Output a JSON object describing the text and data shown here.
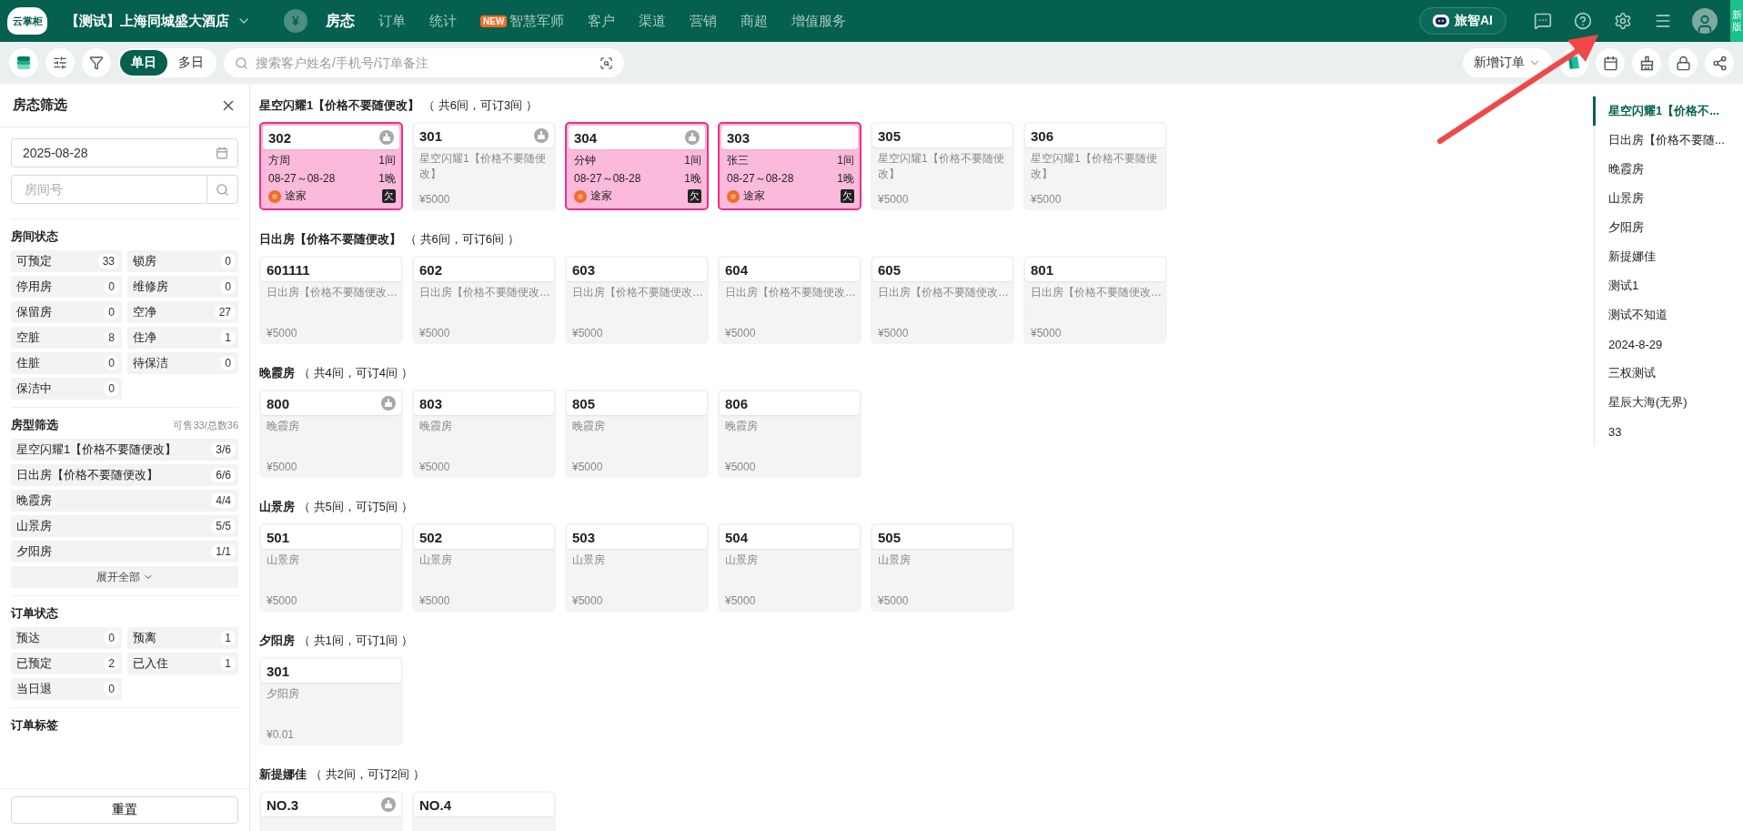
{
  "topbar": {
    "logo": "云掌柜",
    "hotel": "【测试】上海同城盛大酒店",
    "currency": "¥",
    "nav": [
      {
        "label": "房态",
        "selected": true
      },
      {
        "label": "订单",
        "selected": false
      },
      {
        "label": "统计",
        "selected": false
      },
      {
        "label": "智慧军师",
        "selected": false,
        "badge": "NEW"
      },
      {
        "label": "客户",
        "selected": false
      },
      {
        "label": "渠道",
        "selected": false
      },
      {
        "label": "营销",
        "selected": false
      },
      {
        "label": "商超",
        "selected": false
      },
      {
        "label": "增值服务",
        "selected": false
      }
    ],
    "ai_button": "旅智AI",
    "version_tab": "新版"
  },
  "toolbar": {
    "views": [
      {
        "label": "单日",
        "selected": true
      },
      {
        "label": "多日",
        "selected": false
      }
    ],
    "search": {
      "placeholder": "搜索客户姓名/手机号/订单备注"
    },
    "new_order": "新增订单"
  },
  "sidebar": {
    "title": "房态筛选",
    "date": "2025-08-28",
    "room_search": {
      "placeholder": "房间号"
    },
    "room_status": {
      "title": "房间状态",
      "items": [
        {
          "label": "可预定",
          "count": "33"
        },
        {
          "label": "锁房",
          "count": "0"
        },
        {
          "label": "停用房",
          "count": "0"
        },
        {
          "label": "维修房",
          "count": "0"
        },
        {
          "label": "保留房",
          "count": "0"
        },
        {
          "label": "空净",
          "count": "27"
        },
        {
          "label": "空脏",
          "count": "8"
        },
        {
          "label": "住净",
          "count": "1"
        },
        {
          "label": "住脏",
          "count": "0"
        },
        {
          "label": "待保洁",
          "count": "0"
        },
        {
          "label": "保洁中",
          "count": "0"
        }
      ]
    },
    "room_types": {
      "title": "房型筛选",
      "summary": "可售33/总数36",
      "items": [
        {
          "label": "星空闪耀1【价格不要随便改】",
          "count": "3/6"
        },
        {
          "label": "日出房【价格不要随便改】",
          "count": "6/6"
        },
        {
          "label": "晚霞房",
          "count": "4/4"
        },
        {
          "label": "山景房",
          "count": "5/5"
        },
        {
          "label": "夕阳房",
          "count": "1/1"
        }
      ],
      "expand": "展开全部"
    },
    "order_status": {
      "title": "订单状态",
      "items": [
        {
          "label": "预达",
          "count": "0"
        },
        {
          "label": "预离",
          "count": "1"
        },
        {
          "label": "已预定",
          "count": "2"
        },
        {
          "label": "已入住",
          "count": "1"
        },
        {
          "label": "当日退",
          "count": "0"
        }
      ]
    },
    "order_tags": {
      "title": "订单标签"
    },
    "reset": "重置"
  },
  "groups": [
    {
      "name": "星空闪耀1【价格不要随便改】",
      "summary": "（ 共6间，可订3间 ）",
      "rooms": [
        {
          "number": "302",
          "kind": "booked",
          "dirty": true,
          "guest": "方周",
          "rooms": "1间",
          "dates": "08-27～08-28",
          "nights": "1晚",
          "source": "途家",
          "badge": "欠"
        },
        {
          "number": "301",
          "kind": "vacant",
          "dirty": true,
          "type": "星空闪耀1【价格不要随便改】",
          "price": "¥5000"
        },
        {
          "number": "304",
          "kind": "booked",
          "dirty": true,
          "guest": "分钟",
          "rooms": "1间",
          "dates": "08-27～08-28",
          "nights": "1晚",
          "source": "途家",
          "badge": "欠"
        },
        {
          "number": "303",
          "kind": "booked",
          "dirty": false,
          "guest": "张三",
          "rooms": "1间",
          "dates": "08-27～08-28",
          "nights": "1晚",
          "source": "途家",
          "badge": "欠"
        },
        {
          "number": "305",
          "kind": "vacant",
          "dirty": false,
          "type": "星空闪耀1【价格不要随便改】",
          "price": "¥5000"
        },
        {
          "number": "306",
          "kind": "vacant",
          "dirty": false,
          "type": "星空闪耀1【价格不要随便改】",
          "price": "¥5000"
        }
      ]
    },
    {
      "name": "日出房【价格不要随便改】",
      "summary": "（ 共6间，可订6间 ）",
      "rooms": [
        {
          "number": "601111",
          "kind": "vacant",
          "dirty": false,
          "type": "日出房【价格不要随便改…",
          "price": "¥5000"
        },
        {
          "number": "602",
          "kind": "vacant",
          "dirty": false,
          "type": "日出房【价格不要随便改…",
          "price": "¥5000"
        },
        {
          "number": "603",
          "kind": "vacant",
          "dirty": false,
          "type": "日出房【价格不要随便改…",
          "price": "¥5000"
        },
        {
          "number": "604",
          "kind": "vacant",
          "dirty": false,
          "type": "日出房【价格不要随便改…",
          "price": "¥5000"
        },
        {
          "number": "605",
          "kind": "vacant",
          "dirty": false,
          "type": "日出房【价格不要随便改…",
          "price": "¥5000"
        },
        {
          "number": "801",
          "kind": "vacant",
          "dirty": false,
          "type": "日出房【价格不要随便改…",
          "price": "¥5000"
        }
      ]
    },
    {
      "name": "晚霞房",
      "summary": "（ 共4间，可订4间 ）",
      "rooms": [
        {
          "number": "800",
          "kind": "vacant",
          "dirty": true,
          "type": "晚霞房",
          "price": "¥5000"
        },
        {
          "number": "803",
          "kind": "vacant",
          "dirty": false,
          "type": "晚霞房",
          "price": "¥5000"
        },
        {
          "number": "805",
          "kind": "vacant",
          "dirty": false,
          "type": "晚霞房",
          "price": "¥5000"
        },
        {
          "number": "806",
          "kind": "vacant",
          "dirty": false,
          "type": "晚霞房",
          "price": "¥5000"
        }
      ]
    },
    {
      "name": "山景房",
      "summary": "（ 共5间，可订5间 ）",
      "rooms": [
        {
          "number": "501",
          "kind": "vacant",
          "dirty": false,
          "type": "山景房",
          "price": "¥5000"
        },
        {
          "number": "502",
          "kind": "vacant",
          "dirty": false,
          "type": "山景房",
          "price": "¥5000"
        },
        {
          "number": "503",
          "kind": "vacant",
          "dirty": false,
          "type": "山景房",
          "price": "¥5000"
        },
        {
          "number": "504",
          "kind": "vacant",
          "dirty": false,
          "type": "山景房",
          "price": "¥5000"
        },
        {
          "number": "505",
          "kind": "vacant",
          "dirty": false,
          "type": "山景房",
          "price": "¥5000"
        }
      ]
    },
    {
      "name": "夕阳房",
      "summary": "（ 共1间，可订1间 ）",
      "rooms": [
        {
          "number": "301",
          "kind": "vacant",
          "dirty": false,
          "type": "夕阳房",
          "price": "¥0.01"
        }
      ]
    },
    {
      "name": "新提娜佳",
      "summary": "（ 共2间，可订2间 ）",
      "rooms": [
        {
          "number": "NO.3",
          "kind": "vacant",
          "dirty": true
        },
        {
          "number": "NO.4",
          "kind": "vacant",
          "dirty": false
        }
      ]
    }
  ],
  "room_nav": [
    {
      "label": "星空闪耀1【价格不...",
      "selected": true
    },
    {
      "label": "日出房【价格不要随...",
      "selected": false
    },
    {
      "label": "晚霞房",
      "selected": false
    },
    {
      "label": "山景房",
      "selected": false
    },
    {
      "label": "夕阳房",
      "selected": false
    },
    {
      "label": "新提娜佳",
      "selected": false
    },
    {
      "label": "测试1",
      "selected": false
    },
    {
      "label": "测试不知道",
      "selected": false
    },
    {
      "label": "2024-8-29",
      "selected": false
    },
    {
      "label": "三权测试",
      "selected": false
    },
    {
      "label": "星辰大海(无界)",
      "selected": false
    },
    {
      "label": "33",
      "selected": false
    }
  ]
}
